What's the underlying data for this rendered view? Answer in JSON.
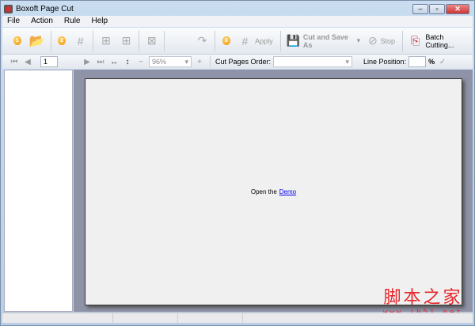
{
  "window": {
    "title": "Boxoft Page Cut",
    "minimize": "–",
    "maximize": "▫",
    "close": "✕"
  },
  "menu": [
    "File",
    "Action",
    "Rule",
    "Help"
  ],
  "toolbar": {
    "step1": "1",
    "step2": "2",
    "step3": "3",
    "apply": "Apply",
    "cut_save": "Cut and Save As",
    "stop": "Stop",
    "batch": "Batch Cutting..."
  },
  "nav": {
    "page": "1",
    "zoom": "96%",
    "order_label": "Cut Pages Order:",
    "order_value": "",
    "line_label": "Line Position:",
    "line_value": "",
    "percent": "%"
  },
  "page": {
    "text": "Open the",
    "link": "Demo"
  },
  "watermark": {
    "cn": "脚本之家",
    "url": "www.jb51.net"
  }
}
